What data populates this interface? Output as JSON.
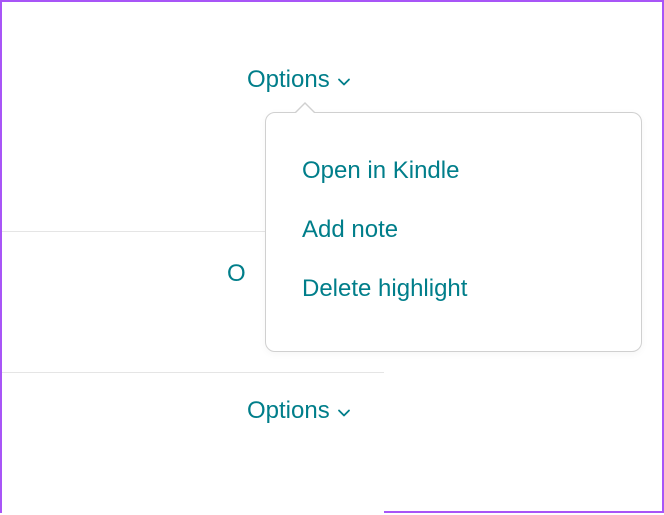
{
  "options": {
    "label": "Options"
  },
  "menu": {
    "items": [
      {
        "label": "Open in Kindle"
      },
      {
        "label": "Add note"
      },
      {
        "label": "Delete highlight"
      }
    ]
  },
  "hidden_label_fragment": "O"
}
